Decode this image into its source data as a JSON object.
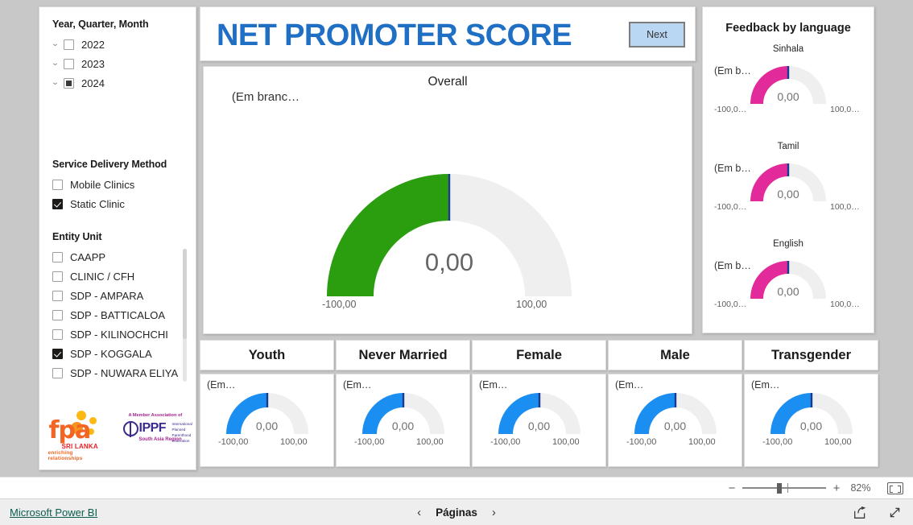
{
  "colors": {
    "title_blue": "#1f6fc4",
    "gauge_green": "#2b9e0f",
    "gauge_blue": "#1b8ef2",
    "gauge_magenta": "#e32a9a",
    "gauge_track": "#f0efef",
    "needle": "#1a3a8f",
    "canvas_bg": "#c8c8c8"
  },
  "sidebar": {
    "year_slicer": {
      "title": "Year, Quarter, Month",
      "items": [
        {
          "label": "2022",
          "state": "unchecked"
        },
        {
          "label": "2023",
          "state": "unchecked"
        },
        {
          "label": "2024",
          "state": "partial"
        }
      ]
    },
    "service_delivery": {
      "title": "Service Delivery Method",
      "items": [
        {
          "label": "Mobile Clinics",
          "state": "unchecked"
        },
        {
          "label": "Static Clinic",
          "state": "checked"
        }
      ]
    },
    "entity_unit": {
      "title": "Entity Unit",
      "items": [
        {
          "label": "CAAPP",
          "state": "unchecked"
        },
        {
          "label": "CLINIC / CFH",
          "state": "unchecked"
        },
        {
          "label": "SDP - AMPARA",
          "state": "unchecked"
        },
        {
          "label": "SDP - BATTICALOA",
          "state": "unchecked"
        },
        {
          "label": "SDP - KILINOCHCHI",
          "state": "unchecked"
        },
        {
          "label": "SDP - KOGGALA",
          "state": "checked"
        },
        {
          "label": "SDP - NUWARA ELIYA",
          "state": "unchecked"
        }
      ]
    },
    "logos": {
      "fpa_name": "fpa",
      "fpa_sub1": "SRI LANKA",
      "fpa_sub2": "enriching  relationships",
      "ippf_top": "A Member Association of",
      "ippf_name": "IPPF",
      "ippf_right": "International\nPlanned Parenthood\nFederation",
      "ippf_bottom": "South Asia Region"
    }
  },
  "header": {
    "title": "NET PROMOTER SCORE",
    "next_label": "Next"
  },
  "overall": {
    "title": "Overall",
    "blank_label": "(Em branc…",
    "value": "0,00",
    "min": "-100,00",
    "max": "100,00"
  },
  "language_panel": {
    "title": "Feedback by language",
    "gauges": [
      {
        "name": "Sinhala",
        "blank_label": "(Em b…",
        "value": "0,00",
        "min": "-100,0…",
        "max": "100,0…"
      },
      {
        "name": "Tamil",
        "blank_label": "(Em b…",
        "value": "0,00",
        "min": "-100,0…",
        "max": "100,0…"
      },
      {
        "name": "English",
        "blank_label": "(Em b…",
        "value": "0,00",
        "min": "-100,0…",
        "max": "100,0…"
      }
    ]
  },
  "demographics": [
    {
      "title": "Youth",
      "blank_label": "(Em…",
      "value": "0,00",
      "min": "-100,00",
      "max": "100,00"
    },
    {
      "title": "Never Married",
      "blank_label": "(Em…",
      "value": "0,00",
      "min": "-100,00",
      "max": "100,00"
    },
    {
      "title": "Female",
      "blank_label": "(Em…",
      "value": "0,00",
      "min": "-100,00",
      "max": "100,00"
    },
    {
      "title": "Male",
      "blank_label": "(Em…",
      "value": "0,00",
      "min": "-100,00",
      "max": "100,00"
    },
    {
      "title": "Transgender",
      "blank_label": "(Em…",
      "value": "0,00",
      "min": "-100,00",
      "max": "100,00"
    }
  ],
  "zoombar": {
    "minus": "−",
    "plus": "+",
    "percent": "82%"
  },
  "footer": {
    "brand": "Microsoft Power BI",
    "prev_arrow": "‹",
    "pages_label": "Páginas",
    "next_arrow": "›"
  },
  "chart_data": {
    "type": "gauge",
    "title": "NET PROMOTER SCORE",
    "axis_range": [
      -100,
      100
    ],
    "gauges": [
      {
        "label": "Overall",
        "value": 0,
        "min": -100,
        "max": 100,
        "fill_color": "#2b9e0f",
        "category": "(Em branco)"
      },
      {
        "label": "Sinhala",
        "value": 0,
        "min": -100,
        "max": 100,
        "fill_color": "#e32a9a",
        "category": "(Em branco)"
      },
      {
        "label": "Tamil",
        "value": 0,
        "min": -100,
        "max": 100,
        "fill_color": "#e32a9a",
        "category": "(Em branco)"
      },
      {
        "label": "English",
        "value": 0,
        "min": -100,
        "max": 100,
        "fill_color": "#e32a9a",
        "category": "(Em branco)"
      },
      {
        "label": "Youth",
        "value": 0,
        "min": -100,
        "max": 100,
        "fill_color": "#1b8ef2",
        "category": "(Em branco)"
      },
      {
        "label": "Never Married",
        "value": 0,
        "min": -100,
        "max": 100,
        "fill_color": "#1b8ef2",
        "category": "(Em branco)"
      },
      {
        "label": "Female",
        "value": 0,
        "min": -100,
        "max": 100,
        "fill_color": "#1b8ef2",
        "category": "(Em branco)"
      },
      {
        "label": "Male",
        "value": 0,
        "min": -100,
        "max": 100,
        "fill_color": "#1b8ef2",
        "category": "(Em branco)"
      },
      {
        "label": "Transgender",
        "value": 0,
        "min": -100,
        "max": 100,
        "fill_color": "#1b8ef2",
        "category": "(Em branco)"
      }
    ]
  }
}
